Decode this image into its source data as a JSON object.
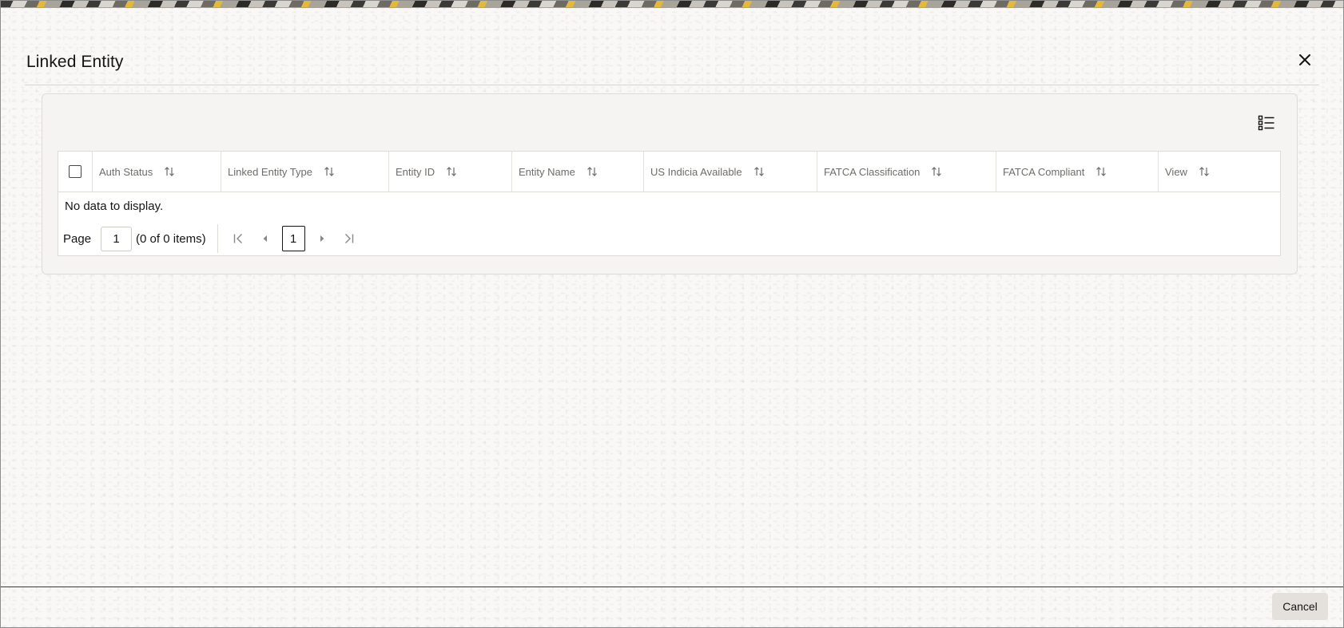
{
  "dialog": {
    "title": "Linked Entity",
    "close_icon": "close-icon"
  },
  "toolbar": {
    "columns_icon": "column-list-icon"
  },
  "grid": {
    "columns": [
      {
        "label": "Auth Status",
        "sort_icon": "sort-icon"
      },
      {
        "label": "Linked Entity Type",
        "sort_icon": "sort-icon"
      },
      {
        "label": "Entity ID",
        "sort_icon": "sort-icon"
      },
      {
        "label": "Entity Name",
        "sort_icon": "sort-icon"
      },
      {
        "label": "US Indicia Available",
        "sort_icon": "sort-icon"
      },
      {
        "label": "FATCA Classification",
        "sort_icon": "sort-icon"
      },
      {
        "label": "FATCA Compliant",
        "sort_icon": "sort-icon"
      },
      {
        "label": "View",
        "sort_icon": "sort-icon"
      }
    ],
    "empty_message": "No data to display."
  },
  "pagination": {
    "page_label": "Page",
    "page_input_value": "1",
    "summary": "(0 of 0 items)",
    "current_page": "1",
    "first_icon": "first-page-icon",
    "prev_icon": "previous-page-icon",
    "next_icon": "next-page-icon",
    "last_icon": "last-page-icon"
  },
  "footer": {
    "cancel_label": "Cancel"
  }
}
